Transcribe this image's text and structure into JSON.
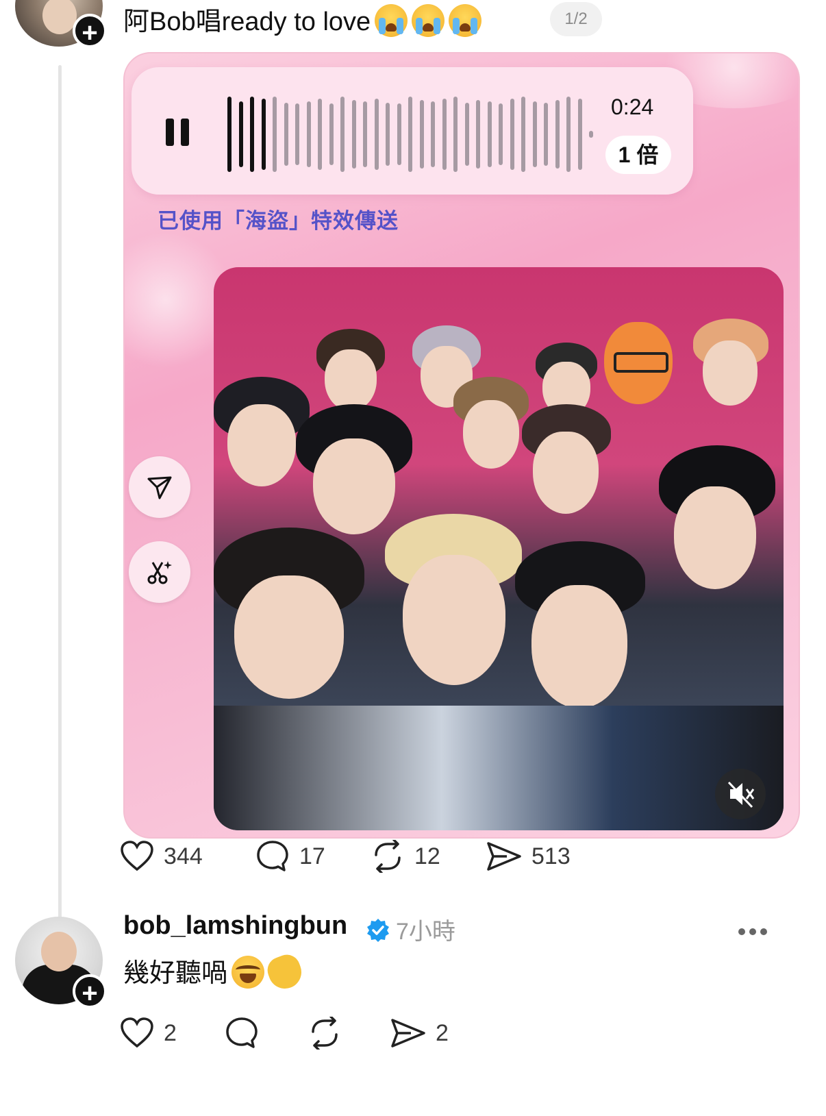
{
  "post": {
    "text": "阿Bob唱ready to love",
    "emojis": [
      "crying-face",
      "crying-face",
      "crying-face"
    ],
    "page_indicator": "1/2",
    "audio": {
      "duration": "0:24",
      "speed": "1 倍",
      "effect_note": "已使用「海盜」特效傳送",
      "progress": 0.11
    },
    "stats": {
      "likes": "344",
      "comments": "17",
      "reposts": "12",
      "shares": "513"
    }
  },
  "reply": {
    "username": "bob_lamshingbun",
    "verified": true,
    "time": "7小時",
    "text": "幾好聽喎",
    "emojis": [
      "face-with-tears-of-joy",
      "clapping-hands"
    ],
    "stats": {
      "likes": "2",
      "comments": "",
      "reposts": "",
      "shares": "2"
    }
  },
  "colors": {
    "card_pink": "#f6a8c8",
    "effect_text": "#5552c8",
    "verified_blue": "#1d9bf0"
  }
}
